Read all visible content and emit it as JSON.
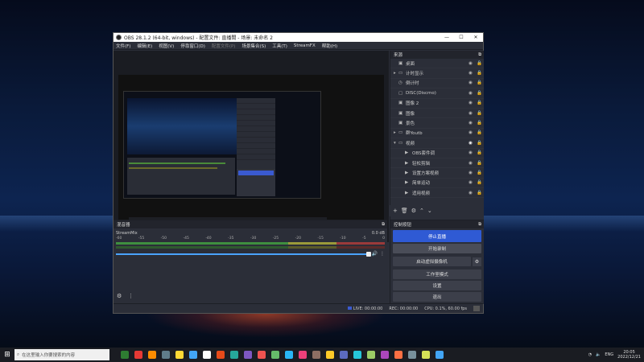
{
  "window": {
    "title": "OBS 28.1.2 (64-bit, windows) - 配置文件: 直播間 - 场景: 未命名 2",
    "min": "—",
    "max": "☐",
    "close": "✕"
  },
  "menu": [
    {
      "label": "文件(F)",
      "disabled": false
    },
    {
      "label": "编辑(E)",
      "disabled": false
    },
    {
      "label": "视图(V)",
      "disabled": false
    },
    {
      "label": "停靠窗口(D)",
      "disabled": false
    },
    {
      "label": "配置文件(P)",
      "disabled": true
    },
    {
      "label": "场景集合(S)",
      "disabled": false
    },
    {
      "label": "工具(T)",
      "disabled": false
    },
    {
      "label": "StreamFX",
      "disabled": false
    },
    {
      "label": "帮助(H)",
      "disabled": false
    }
  ],
  "sources": {
    "title": "来源",
    "items": [
      {
        "label": "桌面",
        "icon": "image-icon",
        "caret": "",
        "indent": false,
        "active": false
      },
      {
        "label": "计时显示",
        "icon": "folder-icon",
        "caret": "▸",
        "indent": false,
        "active": false
      },
      {
        "label": "倒计时",
        "icon": "clock-icon",
        "caret": "",
        "indent": false,
        "active": false
      },
      {
        "label": "DISC(Discmo)",
        "icon": "window-icon",
        "caret": "",
        "indent": false,
        "active": false
      },
      {
        "label": "图像 2",
        "icon": "image-icon",
        "caret": "",
        "indent": false,
        "active": false
      },
      {
        "label": "图像",
        "icon": "image-icon",
        "caret": "",
        "indent": false,
        "active": false
      },
      {
        "label": "景色",
        "icon": "image-icon",
        "caret": "",
        "indent": false,
        "active": false
      },
      {
        "label": "群Youtb",
        "icon": "folder-icon",
        "caret": "▸",
        "indent": false,
        "active": false
      },
      {
        "label": "视频",
        "icon": "folder-icon",
        "caret": "▾",
        "indent": false,
        "active": true
      },
      {
        "label": "OBS套件调",
        "icon": "play-icon",
        "caret": "",
        "indent": true,
        "active": false
      },
      {
        "label": "轻松剪辑",
        "icon": "play-icon",
        "caret": "",
        "indent": true,
        "active": false
      },
      {
        "label": "设置方案视频",
        "icon": "play-icon",
        "caret": "",
        "indent": true,
        "active": false
      },
      {
        "label": "简单运动",
        "icon": "play-icon",
        "caret": "",
        "indent": true,
        "active": false
      },
      {
        "label": "适用视频",
        "icon": "play-icon",
        "caret": "",
        "indent": true,
        "active": false
      }
    ],
    "toolbar": [
      "+",
      "🗑",
      "⚙",
      "⌃",
      "⌄"
    ]
  },
  "mixer": {
    "title": "混音器",
    "track_name": "StreamMix",
    "db": "0.0 dB",
    "ticks": [
      "-60",
      "-55",
      "-50",
      "-45",
      "-40",
      "-35",
      "-30",
      "-25",
      "-20",
      "-15",
      "-10",
      "-5",
      "0"
    ],
    "volume": 0.97
  },
  "controls": {
    "title": "控制按钮",
    "stop_stream": "停止直播",
    "start_record": "开始录制",
    "virtual_cam": "启动虚拟摄像机",
    "studio_mode": "工作室模式",
    "settings": "设置",
    "exit": "退出"
  },
  "status": {
    "live": "LIVE: 00:00:00",
    "rec": "REC: 00:00:00",
    "cpu": "CPU: 0.1%, 60.00 fps"
  },
  "taskbar": {
    "search_placeholder": "在这里输入你要搜索的内容",
    "time": "20:05",
    "date": "2022/12/21",
    "lang": "ENG",
    "icon_colors": [
      "#2e7d32",
      "#e53935",
      "#fb8c00",
      "#607d8b",
      "#fdd835",
      "#42a5f5",
      "#ffffff",
      "#e64a19",
      "#26a69a",
      "#7e57c2",
      "#ef5350",
      "#66bb6a",
      "#29b6f6",
      "#ec407a",
      "#8d6e63",
      "#ffca28",
      "#5c6bc0",
      "#26c6da",
      "#9ccc65",
      "#ab47bc",
      "#ff7043",
      "#78909c",
      "#d4e157",
      "#42a5f5"
    ]
  }
}
